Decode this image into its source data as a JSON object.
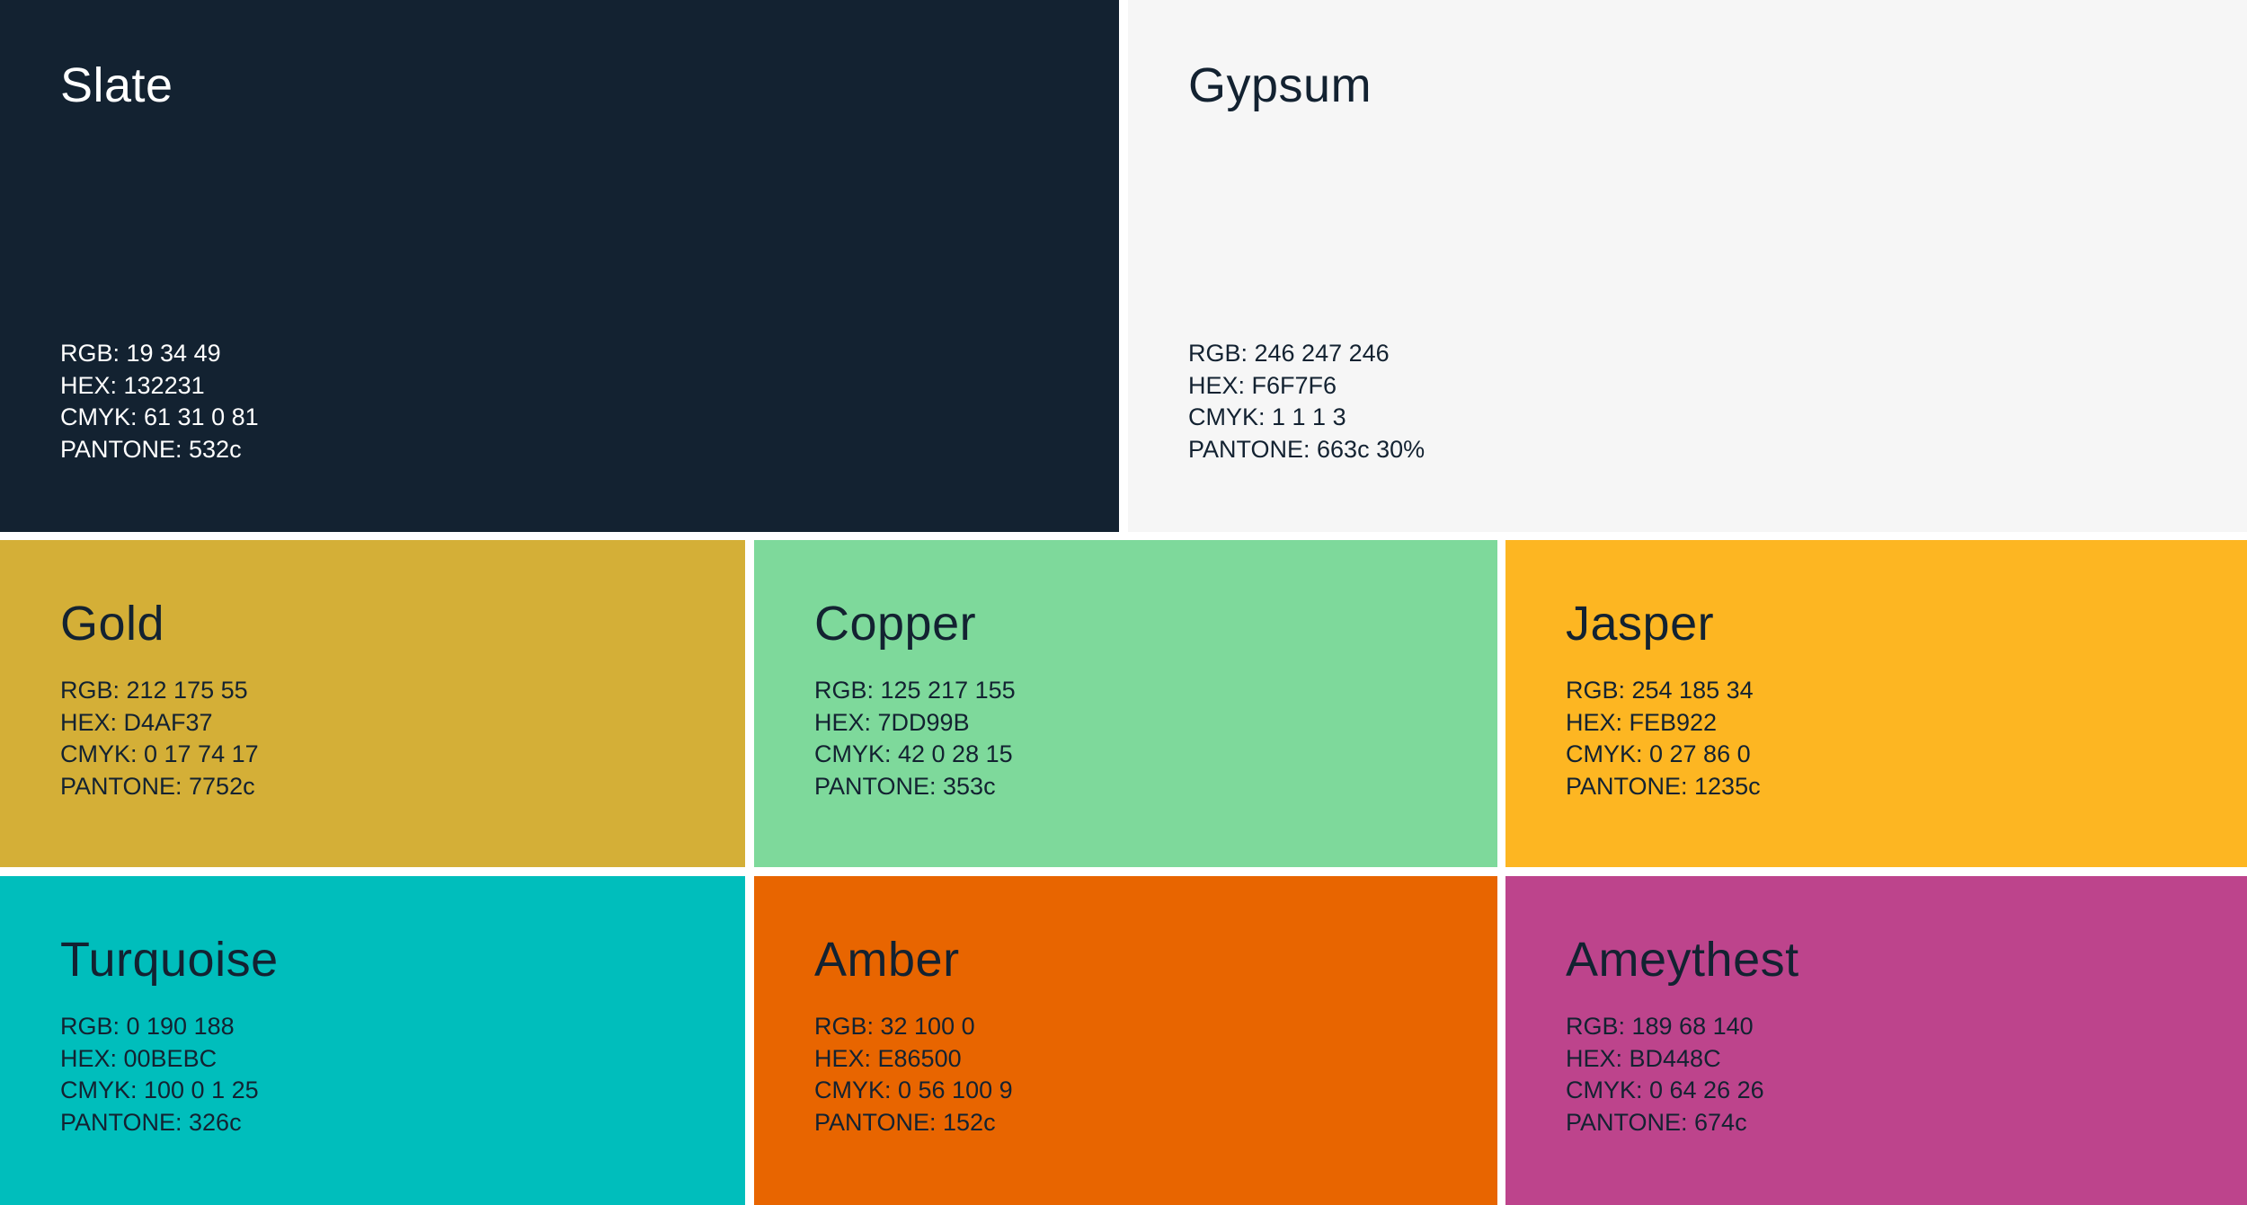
{
  "swatches": {
    "slate": {
      "name": "Slate",
      "bg": "#132231",
      "fg": "#ffffff",
      "rgb": "RGB: 19 34 49",
      "hex": "HEX: 132231",
      "cmyk": "CMYK: 61 31 0 81",
      "pantone": "PANTONE: 532c"
    },
    "gypsum": {
      "name": "Gypsum",
      "bg": "#F6F6F6",
      "fg": "#132231",
      "rgb": "RGB: 246 247 246",
      "hex": "HEX: F6F7F6",
      "cmyk": "CMYK: 1 1 1 3",
      "pantone": "PANTONE: 663c 30%"
    },
    "gold": {
      "name": "Gold",
      "bg": "#D4AF37",
      "fg": "#132231",
      "rgb": "RGB: 212 175 55",
      "hex": "HEX: D4AF37",
      "cmyk": "CMYK: 0 17 74 17",
      "pantone": "PANTONE: 7752c"
    },
    "copper": {
      "name": "Copper",
      "bg": "#7ED99B",
      "fg": "#132231",
      "rgb": "RGB: 125 217 155",
      "hex": "HEX: 7DD99B",
      "cmyk": "CMYK: 42 0 28 15",
      "pantone": "PANTONE: 353c"
    },
    "jasper": {
      "name": "Jasper",
      "bg": "#FDB622",
      "fg": "#132231",
      "rgb": "RGB: 254 185 34",
      "hex": "HEX: FEB922",
      "cmyk": "CMYK: 0 27 86 0",
      "pantone": "PANTONE: 1235c"
    },
    "turquoise": {
      "name": "Turquoise",
      "bg": "#00BEBC",
      "fg": "#132231",
      "rgb": "RGB: 0 190 188",
      "hex": "HEX: 00BEBC",
      "cmyk": "CMYK: 100 0 1 25",
      "pantone": "PANTONE: 326c"
    },
    "amber": {
      "name": "Amber",
      "bg": "#E86500",
      "fg": "#132231",
      "rgb": "RGB: 32 100 0",
      "hex": "HEX: E86500",
      "cmyk": "CMYK: 0 56 100 9",
      "pantone": "PANTONE: 152c"
    },
    "ameythest": {
      "name": "Ameythest",
      "bg": "#BD448C",
      "fg": "#132231",
      "rgb": "RGB: 189 68 140",
      "hex": "HEX: BD448C",
      "cmyk": "CMYK: 0 64 26 26",
      "pantone": "PANTONE: 674c"
    }
  }
}
